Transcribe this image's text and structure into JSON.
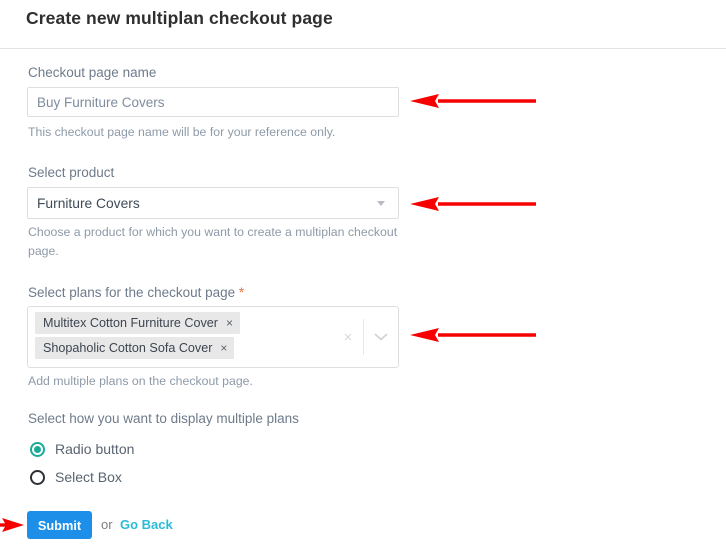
{
  "page": {
    "title": "Create new multiplan checkout page"
  },
  "fields": {
    "checkout_name": {
      "label": "Checkout page name",
      "value": "Buy Furniture Covers",
      "placeholder": "Buy Furniture Covers",
      "help": "This checkout page name will be for your reference only."
    },
    "product": {
      "label": "Select product",
      "value": "Furniture Covers",
      "help": "Choose a product for which you want to create a multiplan checkout page.",
      "caret_icon": "caret-down-icon"
    },
    "plans": {
      "label": "Select plans for the checkout page",
      "required_marker": "*",
      "help": "Add multiple plans on the checkout page.",
      "tags": [
        {
          "label": "Multitex Cotton Furniture Cover",
          "remove_icon": "×"
        },
        {
          "label": "Shopaholic Cotton Sofa Cover",
          "remove_icon": "×"
        }
      ],
      "clear_icon": "×",
      "chevron_icon": "chevron-down-icon"
    },
    "display_mode": {
      "label": "Select how you want to display multiple plans",
      "options": [
        {
          "label": "Radio button",
          "selected": true
        },
        {
          "label": "Select Box",
          "selected": false
        }
      ]
    }
  },
  "actions": {
    "submit_label": "Submit",
    "or_label": "or",
    "go_back_label": "Go Back"
  },
  "colors": {
    "accent_blue": "#1d8fe8",
    "link_teal": "#2bbbd8",
    "radio_green": "#1aab98",
    "required_orange": "#e8743b",
    "annotation_red": "#f60000",
    "label_gray": "#6e7b8b",
    "help_gray": "#8d9aa8",
    "tag_bg": "#e8e8e8"
  },
  "annotations": [
    {
      "name": "arrow-to-checkout-name-field",
      "direction": "left"
    },
    {
      "name": "arrow-to-product-select",
      "direction": "left"
    },
    {
      "name": "arrow-to-plans-multiselect",
      "direction": "left"
    },
    {
      "name": "arrow-to-submit-button",
      "direction": "right"
    }
  ]
}
